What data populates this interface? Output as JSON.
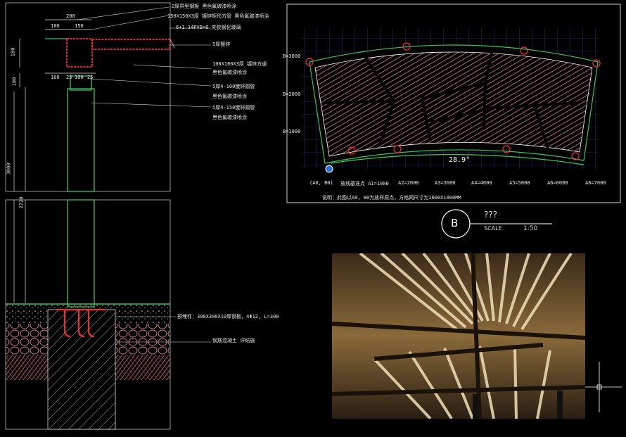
{
  "section_drawing": {
    "labels": [
      "2厚异型钢板 黑色氟碳漆喷涂",
      "150X150X3厚 镀锌矩形方管 黑色氟碳漆喷涂",
      "6+1.14PVB+6 夹胶钢化玻璃",
      "5厚镀锌",
      "100X100X3厚 镀锌方通",
      "黑色氟碳漆喷涂",
      "5厚4-100镀锌圆管",
      "黑色氟碳漆喷涂",
      "5厚4-150镀锌圆管",
      "黑色氟碳漆喷涂",
      "预埋件：300X300X10厚钢板，4Φ12, L=300",
      "钢筋混凝土 详结施"
    ],
    "dimensions": [
      "200",
      "100",
      "150",
      "180",
      "100",
      "25",
      "100",
      "25",
      "100",
      "3000",
      "2720"
    ]
  },
  "plan_drawing": {
    "row_labels": [
      "B=3000",
      "B=2000",
      "B=1000"
    ],
    "column_labels": [
      "(A0, B0)",
      "放线基准点 A1=1000",
      "A2=2000",
      "A3=3000",
      "A4=4000",
      "A5=5000",
      "A6=6000",
      "A8=7000"
    ],
    "angle_label": "28.9°",
    "note": "说明：此图以A0, B0为放样原点，方格网尺寸为1000X1000MM"
  },
  "title_block": {
    "letter": "B",
    "title": "???",
    "scale_label": "SCALE",
    "scale_value": "1:50"
  },
  "colors": {
    "background": "#000000",
    "cad_white": "#e6e6e6",
    "red": "#ff2a2a",
    "green": "#34c759",
    "grid": "#2a4fd1",
    "hatch": "#d97070"
  }
}
